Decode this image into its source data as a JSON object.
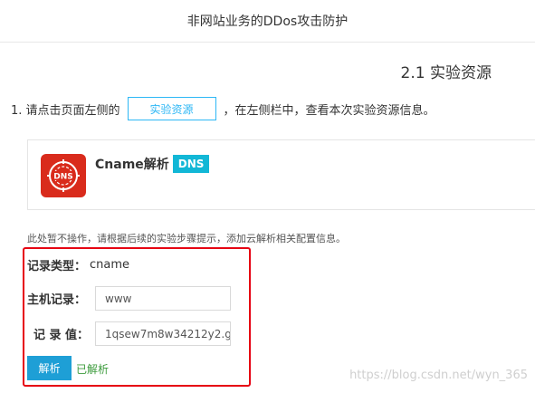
{
  "header": {
    "title": "非网站业务的DDos攻击防护"
  },
  "section": {
    "title": "2.1 实验资源"
  },
  "step": {
    "prefix": "1. 请点击页面左侧的",
    "button_label": "实验资源",
    "suffix": "，在左侧栏中，查看本次实验资源信息。"
  },
  "resource_card": {
    "logo_text": "DNS",
    "name": "Cname解析",
    "badge": "DNS"
  },
  "hint_text": "此处暂不操作，请根据后续的实验步骤提示，添加云解析相关配置信息。",
  "form": {
    "record_type_label": "记录类型：",
    "record_type_value": "cname",
    "host_label": "主机记录：",
    "host_value": "www",
    "record_value_label": "记 录 值：",
    "record_value_value": "1qsew7m8w34212y2.g",
    "parse_button": "解析",
    "status": "已解析"
  },
  "watermark": "https://blog.csdn.net/wyn_365",
  "colors": {
    "accent": "#2db7f5",
    "highlight_border": "#e60012",
    "logo_red": "#d92b1c",
    "badge": "#12b7d6",
    "success": "#3c9b3c"
  }
}
